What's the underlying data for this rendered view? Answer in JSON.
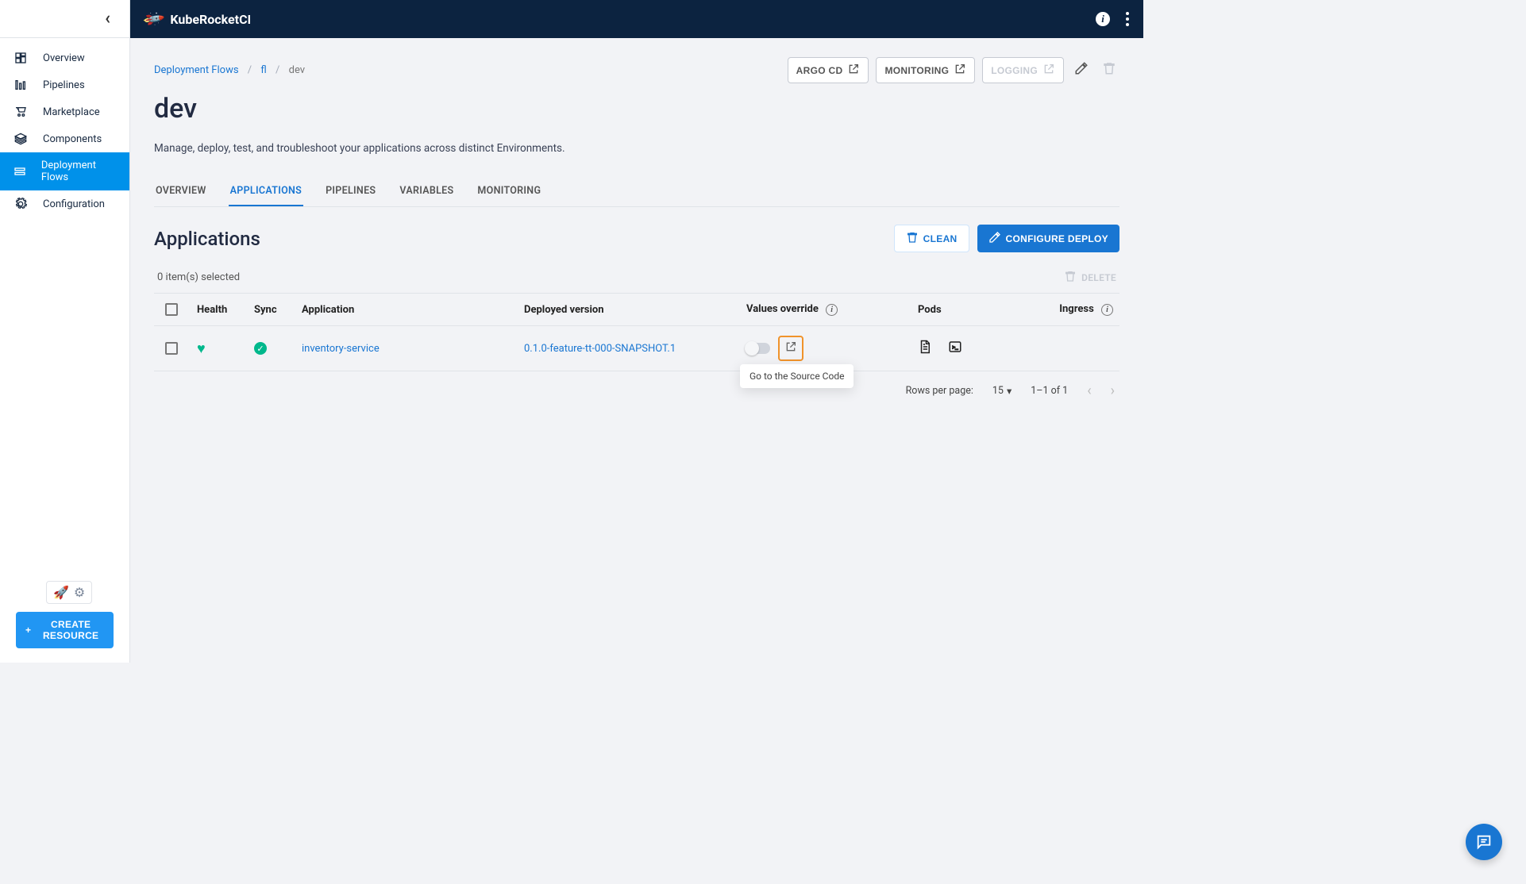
{
  "brand": "KubeRocketCI",
  "sidebar": {
    "items": [
      {
        "label": "Overview"
      },
      {
        "label": "Pipelines"
      },
      {
        "label": "Marketplace"
      },
      {
        "label": "Components"
      },
      {
        "label": "Deployment Flows"
      },
      {
        "label": "Configuration"
      }
    ],
    "create_label": "CREATE RESOURCE"
  },
  "breadcrumbs": {
    "root": "Deployment Flows",
    "mid": "fl",
    "current": "dev"
  },
  "header_actions": {
    "argocd": "ARGO CD",
    "monitoring": "MONITORING",
    "logging": "LOGGING"
  },
  "page": {
    "title": "dev",
    "subtitle": "Manage, deploy, test, and troubleshoot your applications across distinct Environments."
  },
  "tabs": [
    {
      "label": "OVERVIEW"
    },
    {
      "label": "APPLICATIONS"
    },
    {
      "label": "PIPELINES"
    },
    {
      "label": "VARIABLES"
    },
    {
      "label": "MONITORING"
    }
  ],
  "section": {
    "heading": "Applications",
    "clean_label": "CLEAN",
    "configure_label": "CONFIGURE DEPLOY",
    "selected_text": "0 item(s) selected",
    "delete_label": "DELETE"
  },
  "table": {
    "headers": {
      "health": "Health",
      "sync": "Sync",
      "application": "Application",
      "deployed": "Deployed version",
      "values_override": "Values override",
      "pods": "Pods",
      "ingress": "Ingress"
    },
    "rows": [
      {
        "application": "inventory-service",
        "deployed_version": "0.1.0-feature-tt-000-SNAPSHOT.1"
      }
    ]
  },
  "tooltip": "Go to the Source Code",
  "pager": {
    "rows_label": "Rows per page:",
    "page_size": "15",
    "range": "1–1 of 1"
  }
}
